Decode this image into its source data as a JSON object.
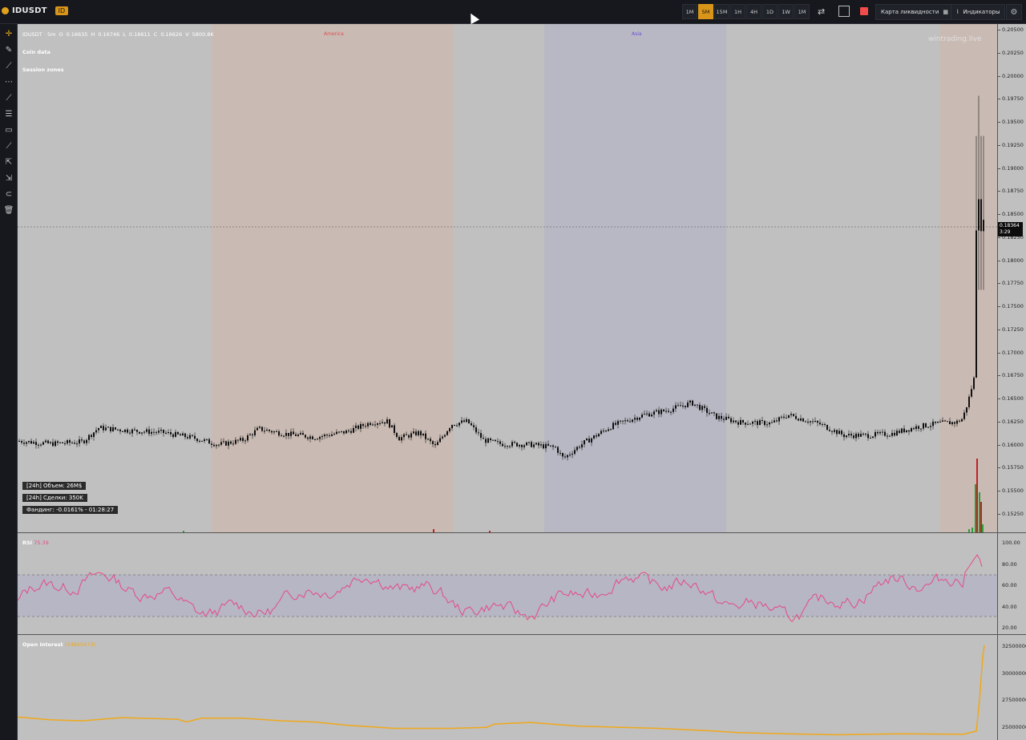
{
  "topbar": {
    "brand_name": "IDUSDT",
    "brand_badge": "ID",
    "timeframes": [
      "1M",
      "5M",
      "15M",
      "1H",
      "4H",
      "1D",
      "1W",
      "1M"
    ],
    "active_timeframe_index": 1,
    "liquidity_map_label": "Карта ликвидности",
    "indicators_label": "Индикаторы"
  },
  "chart": {
    "info": {
      "symbol": "IDUSDT · 5m",
      "o_label": "O",
      "o_value": "0.16635",
      "h_label": "H",
      "h_value": "0.16746",
      "l_label": "L",
      "l_value": "0.16611",
      "c_label": "C",
      "c_value": "0.16626",
      "v_label": "V",
      "v_value": "5800.8K"
    },
    "legend_coin_data": "Coin data",
    "legend_session_zones": "Session zones",
    "session_america": "America",
    "session_asia": "Asia",
    "watermark": "wintrading.live",
    "stats": {
      "volume": "[24h] Объем: 26M$",
      "trades": "[24h] Сделки: 350K",
      "funding": "Фандинг: -0.0161% - 01:28:27"
    },
    "current_price": "0.18364",
    "current_countdown": "3:29",
    "price_ticks": [
      "0.20500",
      "0.20250",
      "0.20000",
      "0.19750",
      "0.19500",
      "0.19250",
      "0.19000",
      "0.18750",
      "0.18500",
      "0.18250",
      "0.18000",
      "0.17750",
      "0.17500",
      "0.17250",
      "0.17000",
      "0.16750",
      "0.16500",
      "0.16250",
      "0.16000",
      "0.15750",
      "0.15500",
      "0.15250"
    ]
  },
  "rsi": {
    "label": "RSI",
    "value": "75.39",
    "ticks": [
      "100.00",
      "80.00",
      "60.00",
      "40.00",
      "20.00"
    ]
  },
  "open_interest": {
    "label": "Open Interest",
    "value": "(34850473)",
    "ticks": [
      "32500000",
      "30000000",
      "27500000",
      "25000000"
    ]
  },
  "colors": {
    "accent": "#d9951a",
    "rsi_line": "#e64a8a",
    "oi_line": "#f0a819",
    "america_zone": "#c9bab3",
    "asia_zone": "#b8b8c4",
    "candle_up_vol": "#2e9c3a",
    "candle_down_vol": "#c02020"
  },
  "chart_data": {
    "type": "candlestick",
    "y_range": [
      0.151,
      0.2055
    ],
    "price_path": [
      [
        0,
        0.1608
      ],
      [
        40,
        0.1605
      ],
      [
        80,
        0.1607
      ],
      [
        100,
        0.1622
      ],
      [
        140,
        0.1619
      ],
      [
        180,
        0.1617
      ],
      [
        220,
        0.1611
      ],
      [
        250,
        0.1604
      ],
      [
        280,
        0.1609
      ],
      [
        300,
        0.1621
      ],
      [
        330,
        0.1616
      ],
      [
        370,
        0.1612
      ],
      [
        410,
        0.1618
      ],
      [
        440,
        0.1628
      ],
      [
        460,
        0.1629
      ],
      [
        475,
        0.1611
      ],
      [
        500,
        0.1617
      ],
      [
        520,
        0.1602
      ],
      [
        540,
        0.1626
      ],
      [
        560,
        0.1629
      ],
      [
        580,
        0.1609
      ],
      [
        600,
        0.1605
      ],
      [
        640,
        0.1604
      ],
      [
        670,
        0.1601
      ],
      [
        680,
        0.1589
      ],
      [
        700,
        0.1603
      ],
      [
        740,
        0.1624
      ],
      [
        780,
        0.1636
      ],
      [
        810,
        0.1641
      ],
      [
        840,
        0.1649
      ],
      [
        870,
        0.1634
      ],
      [
        900,
        0.1628
      ],
      [
        940,
        0.1627
      ],
      [
        960,
        0.1636
      ],
      [
        1000,
        0.1626
      ],
      [
        1030,
        0.1614
      ],
      [
        1060,
        0.1614
      ],
      [
        1090,
        0.1616
      ],
      [
        1120,
        0.1623
      ],
      [
        1150,
        0.1627
      ],
      [
        1170,
        0.1628
      ],
      [
        1178,
        0.1632
      ],
      [
        1185,
        0.1651
      ],
      [
        1193,
        0.1678
      ],
      [
        1196,
        0.1915
      ],
      [
        1200,
        0.1825
      ],
      [
        1204,
        0.1848
      ],
      [
        1206,
        0.1836
      ]
    ]
  }
}
